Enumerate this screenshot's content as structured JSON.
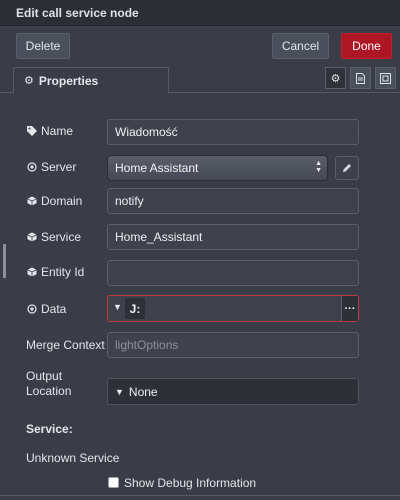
{
  "dialog": {
    "title": "Edit call service node"
  },
  "toolbar": {
    "delete_label": "Delete",
    "cancel_label": "Cancel",
    "done_label": "Done"
  },
  "tabs": {
    "properties_label": "Properties",
    "gear_glyph": "⚙"
  },
  "form": {
    "name": {
      "label": "Name",
      "value": "Wiadomość"
    },
    "server": {
      "label": "Server",
      "value": "Home Assistant"
    },
    "domain": {
      "label": "Domain",
      "value": "notify"
    },
    "service": {
      "label": "Service",
      "value": "Home_Assistant"
    },
    "entity_id": {
      "label": "Entity Id",
      "value": ""
    },
    "data": {
      "label": "Data",
      "type_glyph": "J:",
      "value": ""
    },
    "merge_context": {
      "label": "Merge Context",
      "placeholder": "lightOptions"
    },
    "output_location": {
      "label_line1": "Output",
      "label_line2": "Location",
      "value": "None"
    }
  },
  "service_info": {
    "heading": "Service:",
    "text": "Unknown Service"
  },
  "debug": {
    "label": "Show Debug Information",
    "checked": false
  },
  "colors": {
    "accent_done": "#ad1625",
    "error_border": "#c0393e",
    "background": "#3a3d48"
  },
  "icons": {
    "tab_settings": "gear-icon",
    "tab_description": "document-icon",
    "tab_appearance": "frame-icon",
    "name": "tag-icon",
    "server": "dot-circle-icon",
    "domain": "cube-icon",
    "service": "cube-icon",
    "entity_id": "cube-icon",
    "data": "dot-circle-icon",
    "pencil": "pencil-icon"
  }
}
